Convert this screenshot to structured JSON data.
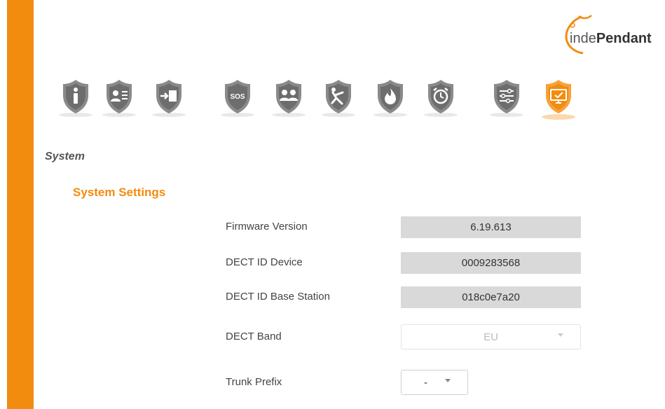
{
  "brand": {
    "logo_prefix": "inde",
    "logo_suffix": "Pendant",
    "accent_color": "#f28c0f"
  },
  "nav": {
    "items": [
      {
        "icon": "info-icon",
        "active": false
      },
      {
        "icon": "contacts-list-icon",
        "active": false
      },
      {
        "icon": "login-icon",
        "active": false
      },
      {
        "icon": "sos-icon",
        "active": false,
        "text": "SOS"
      },
      {
        "icon": "group-icon",
        "active": false
      },
      {
        "icon": "fall-detection-icon",
        "active": false
      },
      {
        "icon": "fire-icon",
        "active": false
      },
      {
        "icon": "alarm-clock-icon",
        "active": false
      },
      {
        "icon": "settings-sliders-icon",
        "active": false
      },
      {
        "icon": "system-monitor-icon",
        "active": true
      }
    ]
  },
  "page": {
    "section_title": "System",
    "subsection_title": "System Settings"
  },
  "fields": {
    "firmware_label": "Firmware Version",
    "firmware_value": "6.19.613",
    "dect_device_label": "DECT ID Device",
    "dect_device_value": "0009283568",
    "dect_base_label": "DECT ID Base Station",
    "dect_base_value": "018c0e7a20",
    "dect_band_label": "DECT Band",
    "dect_band_value": "EU",
    "trunk_prefix_label": "Trunk Prefix",
    "trunk_prefix_value": "-"
  }
}
